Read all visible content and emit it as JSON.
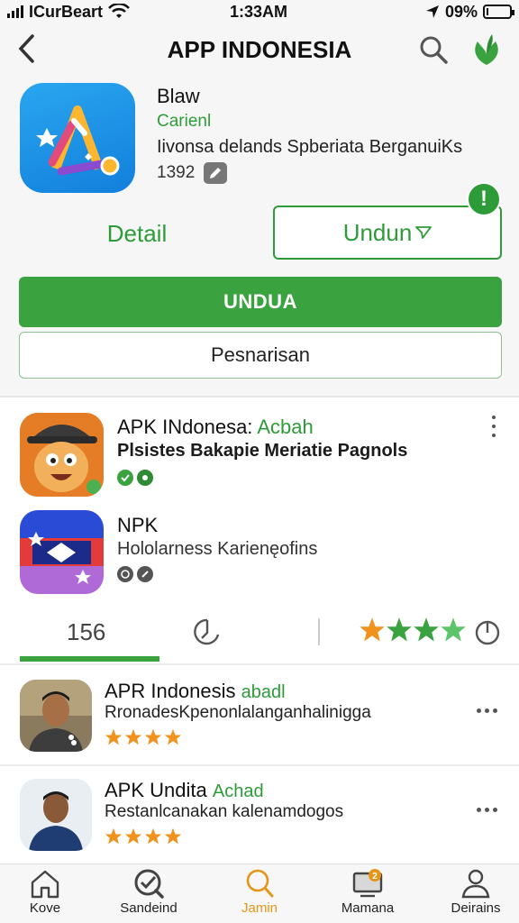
{
  "status": {
    "carrier": "ICurBeart",
    "time": "1:33AM",
    "battery": "09%",
    "battery_level": 0.09
  },
  "header": {
    "title": "APP INDONESIA"
  },
  "app": {
    "name": "Blaw",
    "developer": "Carienl",
    "description": "Iivonsa delands Spberiata BerganuiKs",
    "size": "1392",
    "detail_label": "Detail",
    "download_outline_label": "Undun",
    "alert_badge": "!",
    "download_primary_label": "UNDUA",
    "secondary_label": "Pesnarisan"
  },
  "list_apps": [
    {
      "title": "APK INdonesa:",
      "title_green": "Acbah",
      "subtitle": "Plsistes Bakapie Meriatie Pagnols"
    },
    {
      "title": "NPK",
      "title_green": "",
      "subtitle": "Hololarness Karienęofins"
    }
  ],
  "stats": {
    "count": "156",
    "rating_stars": 4
  },
  "people": [
    {
      "title": "APR Indonesis",
      "title_green": "abadl",
      "subtitle": "RronadesKpenonlalanganhalinigga",
      "stars": 4
    },
    {
      "title": "APK Undita",
      "title_green": "Achad",
      "subtitle": "Restanlcanakan kalenamdogos",
      "stars": 4
    }
  ],
  "tabs": [
    {
      "label": "Kove",
      "icon": "home-icon"
    },
    {
      "label": "Sandeind",
      "icon": "check-search-icon"
    },
    {
      "label": "Jamin",
      "icon": "search-icon",
      "active": true
    },
    {
      "label": "Mamana",
      "icon": "monitor-icon",
      "badge": "2"
    },
    {
      "label": "Deirains",
      "icon": "user-icon"
    }
  ],
  "colors": {
    "green": "#2e9b39",
    "accent_orange": "#e59618",
    "star_orange": "#f0921e"
  }
}
